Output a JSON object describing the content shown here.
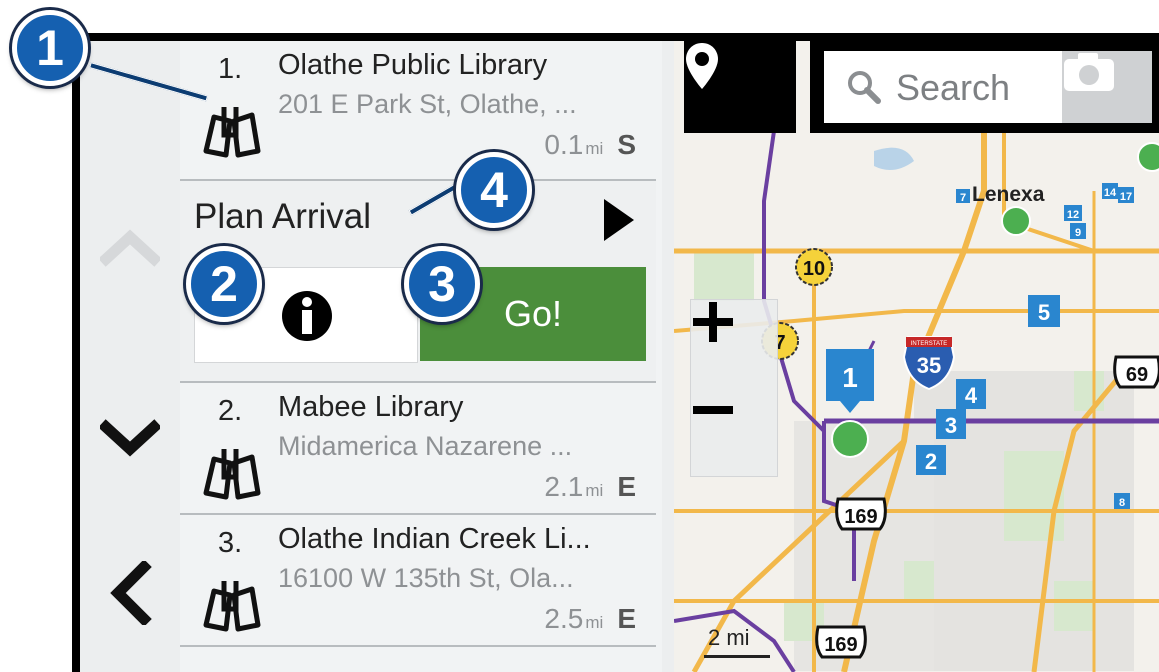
{
  "callouts": [
    "1",
    "2",
    "3",
    "4"
  ],
  "results": [
    {
      "num": "1.",
      "name": "Olathe Public Library",
      "address": "201 E Park St, Olathe, ...",
      "distance": "0.1",
      "unit": "mi",
      "direction": "S"
    },
    {
      "num": "2.",
      "name": "Mabee Library",
      "address": "Midamerica Nazarene ...",
      "distance": "2.1",
      "unit": "mi",
      "direction": "E"
    },
    {
      "num": "3.",
      "name": "Olathe Indian Creek Li...",
      "address": "16100 W 135th St, Ola...",
      "distance": "2.5",
      "unit": "mi",
      "direction": "E"
    }
  ],
  "detail": {
    "plan_label": "Plan Arrival",
    "go_label": "Go!"
  },
  "search": {
    "placeholder": "Search"
  },
  "map": {
    "scale_label": "2 mi",
    "city_label": "Lenexa",
    "highway_shields": {
      "h10": "10",
      "h7": "7",
      "interstate": "35",
      "us169_a": "169",
      "us169_b": "169",
      "us69": "69"
    },
    "result_markers": [
      "1",
      "2",
      "3",
      "4",
      "5"
    ],
    "small_markers": [
      "7",
      "12",
      "14",
      "17",
      "9",
      "8"
    ],
    "interstate_label": "INTERSTATE"
  },
  "colors": {
    "go_green": "#4b8e3b",
    "callout_blue": "#1560b0",
    "route_purple": "#6a3fa0",
    "road_orange": "#f2b84a",
    "marker_blue": "#2a86cf",
    "park_green": "#cfe3c6",
    "water": "#b9d3e8"
  },
  "icons": {
    "pin": "map-pin-icon",
    "search": "magnifier-icon",
    "camera": "camera-icon",
    "category": "library-books-icon"
  }
}
